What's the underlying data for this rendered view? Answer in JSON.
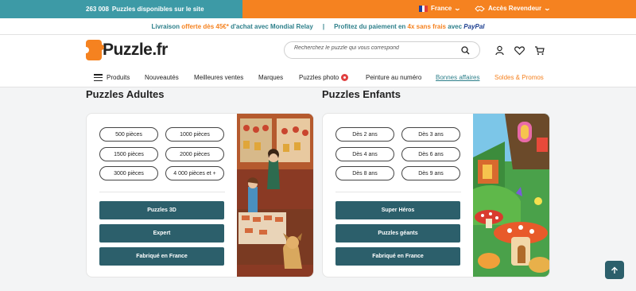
{
  "topbar": {
    "count": "263 008",
    "count_text": "Puzzles disponibles sur le site",
    "language": "France",
    "reseller": "Accès Revendeur"
  },
  "promo": {
    "part1": "Livraison",
    "highlight1": "offerte dès 45€*",
    "part2": "d'achat avec Mondial Relay",
    "separator": "|",
    "part3": "Profitez du paiement en",
    "highlight2": "4x sans frais",
    "part4": "avec",
    "paypal": "PayPal"
  },
  "header": {
    "logo_text": "Puzzle.fr",
    "search_placeholder": "Recherchez le puzzle qui vous correspond"
  },
  "nav": {
    "items": [
      "Produits",
      "Nouveautés",
      "Meilleures ventes",
      "Marques",
      "Puzzles photo",
      "Peinture au numéro",
      "Bonnes affaires",
      "Soldes & Promos"
    ]
  },
  "adults": {
    "title": "Puzzles Adultes",
    "pills": [
      "500 pièces",
      "1000 pièces",
      "1500 pièces",
      "2000 pièces",
      "3000 pièces",
      "4 000 pièces et +"
    ],
    "buttons": [
      "Puzzles 3D",
      "Expert",
      "Fabriqué en France"
    ]
  },
  "kids": {
    "title": "Puzzles Enfants",
    "pills": [
      "Dès 2 ans",
      "Dès 3 ans",
      "Dès 4 ans",
      "Dès 6 ans",
      "Dès 8 ans",
      "Dès 9 ans"
    ],
    "buttons": [
      "Super Héros",
      "Puzzles géants",
      "Fabriqué en France"
    ]
  },
  "colors": {
    "teal": "#3d9aa6",
    "orange": "#f58220",
    "dark_teal": "#2c5f6b"
  }
}
